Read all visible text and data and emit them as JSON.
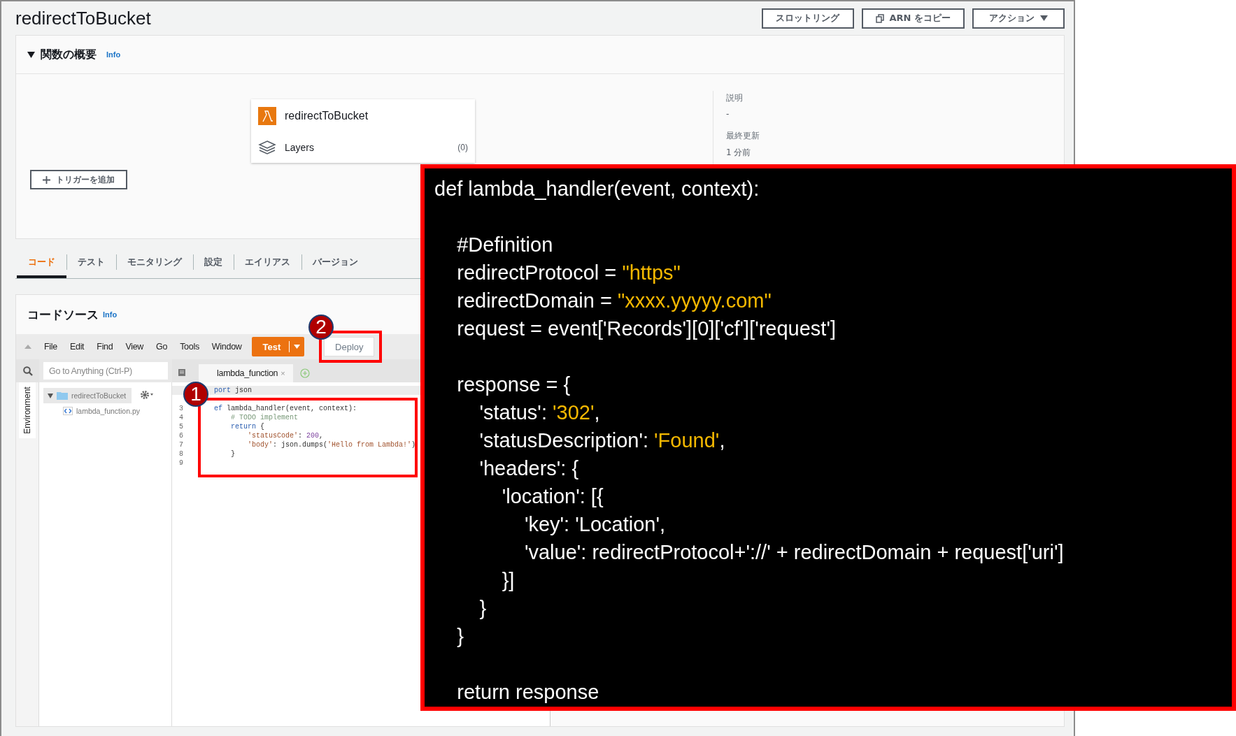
{
  "page_title": "redirectToBucket",
  "header_buttons": [
    {
      "label": "スロットリング",
      "kind": "plain"
    },
    {
      "label": "ARN をコピー",
      "kind": "copy"
    },
    {
      "label": "アクション",
      "kind": "dropdown"
    }
  ],
  "overview": {
    "title": "関数の概要",
    "expanded": true,
    "info_link": "Info",
    "function_name": "redirectToBucket",
    "layers_label": "Layers",
    "layers_count": "(0)",
    "add_trigger": "トリガーを追加",
    "details": [
      {
        "label": "説明",
        "value": "-"
      },
      {
        "label": "最終更新",
        "value": "1 分前"
      }
    ]
  },
  "tabs": [
    {
      "label": "コード",
      "selected": true
    },
    {
      "label": "テスト",
      "selected": false
    },
    {
      "label": "モニタリング",
      "selected": false
    },
    {
      "label": "設定",
      "selected": false
    },
    {
      "label": "エイリアス",
      "selected": false
    },
    {
      "label": "バージョン",
      "selected": false
    }
  ],
  "code_source": {
    "title": "コードソース",
    "info_link": "Info",
    "menu": [
      "File",
      "Edit",
      "Find",
      "View",
      "Go",
      "Tools",
      "Window"
    ],
    "test_button": "Test",
    "deploy_button": "Deploy",
    "search": {
      "placeholder": "Go to Anything (Ctrl-P)"
    },
    "side_tab": "Environment",
    "tree": [
      {
        "name": "redirectToBucket",
        "kind": "folder",
        "expanded": true,
        "children": [
          {
            "name": "lambda_function.py",
            "kind": "file"
          }
        ]
      }
    ],
    "editor_tab": "lambda_function",
    "editor_tab_close": "×",
    "editor_lines": [
      {
        "active": true,
        "segments": [
          {
            "text": "port",
            "kind": "keyword"
          },
          {
            "text": " json",
            "kind": "plain"
          }
        ]
      },
      {
        "active": false
      },
      {
        "number": "3",
        "active": false,
        "segments": [
          {
            "text": "ef",
            "kind": "keyword"
          },
          {
            "text": " lambda_handler(event, context):",
            "kind": "plain"
          }
        ]
      },
      {
        "number": "4",
        "active": false,
        "segments": [
          {
            "text": "    # TODO implement",
            "kind": "comment"
          }
        ]
      },
      {
        "number": "5",
        "active": false,
        "segments": [
          {
            "text": "    return",
            "kind": "keyword"
          },
          {
            "text": " {",
            "kind": "plain"
          }
        ]
      },
      {
        "number": "6",
        "active": false,
        "segments": [
          {
            "text": "        'statusCode'",
            "kind": "string"
          },
          {
            "text": ": ",
            "kind": "plain"
          },
          {
            "text": "200",
            "kind": "number"
          },
          {
            "text": ",",
            "kind": "plain"
          }
        ]
      },
      {
        "number": "7",
        "active": false,
        "segments": [
          {
            "text": "        'body'",
            "kind": "string"
          },
          {
            "text": ": json.dumps(",
            "kind": "plain"
          },
          {
            "text": "'Hello from Lambda!'",
            "kind": "string"
          },
          {
            "text": ")",
            "kind": "plain"
          }
        ]
      },
      {
        "number": "8",
        "active": false,
        "segments": [
          {
            "text": "    }",
            "kind": "plain"
          }
        ]
      },
      {
        "number": "9",
        "active": false
      }
    ]
  },
  "annotations": [
    {
      "label": "1"
    },
    {
      "label": "2"
    }
  ],
  "code_panel": {
    "lines": [
      {
        "segments": [
          {
            "text": "def lambda_handler(event, context):",
            "kind": "plain"
          }
        ]
      },
      {
        "kind": "blank"
      },
      {
        "segments": [
          {
            "text": "    #Definition",
            "kind": "plain"
          }
        ]
      },
      {
        "segments": [
          {
            "text": "    redirectProtocol = ",
            "kind": "plain"
          },
          {
            "text": "\"https\"",
            "kind": "string"
          }
        ]
      },
      {
        "segments": [
          {
            "text": "    redirectDomain = ",
            "kind": "plain"
          },
          {
            "text": "\"xxxx.yyyyy.com\"",
            "kind": "string"
          }
        ]
      },
      {
        "segments": [
          {
            "text": "    request = event['Records'][0]['cf']['request']",
            "kind": "plain"
          }
        ]
      },
      {
        "kind": "blank"
      },
      {
        "segments": [
          {
            "text": "    response = {",
            "kind": "plain"
          }
        ]
      },
      {
        "segments": [
          {
            "text": "        'status': ",
            "kind": "plain"
          },
          {
            "text": "'302'",
            "kind": "string"
          },
          {
            "text": ",",
            "kind": "plain"
          }
        ]
      },
      {
        "segments": [
          {
            "text": "        'statusDescription': ",
            "kind": "plain"
          },
          {
            "text": "'Found'",
            "kind": "string"
          },
          {
            "text": ",",
            "kind": "plain"
          }
        ]
      },
      {
        "segments": [
          {
            "text": "        'headers': {",
            "kind": "plain"
          }
        ]
      },
      {
        "segments": [
          {
            "text": "            'location': [{",
            "kind": "plain"
          }
        ]
      },
      {
        "segments": [
          {
            "text": "                'key': 'Location',",
            "kind": "plain"
          }
        ]
      },
      {
        "segments": [
          {
            "text": "                'value': redirectProtocol+'://' + redirectDomain + request['uri']",
            "kind": "plain"
          }
        ]
      },
      {
        "segments": [
          {
            "text": "            }]",
            "kind": "plain"
          }
        ]
      },
      {
        "segments": [
          {
            "text": "        }",
            "kind": "plain"
          }
        ]
      },
      {
        "segments": [
          {
            "text": "    }",
            "kind": "plain"
          }
        ]
      },
      {
        "kind": "blank"
      },
      {
        "segments": [
          {
            "text": "    return response",
            "kind": "plain"
          }
        ]
      }
    ]
  }
}
